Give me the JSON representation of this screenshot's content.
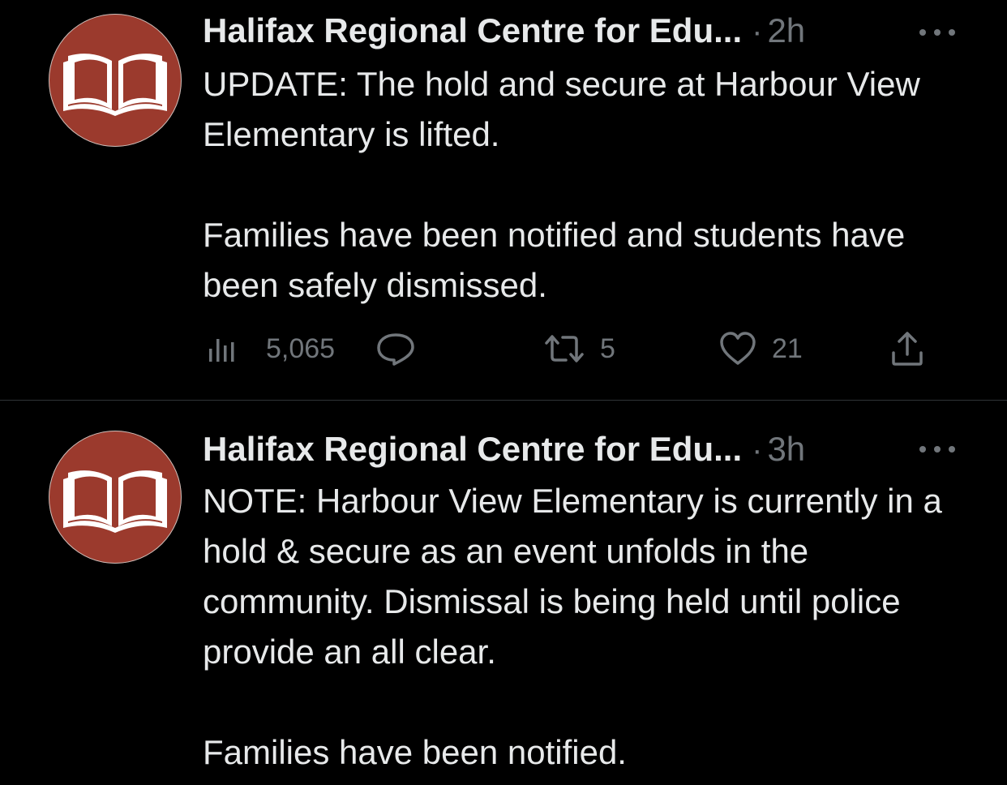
{
  "tweets": [
    {
      "author": "Halifax Regional Centre for Edu...",
      "separator": "·",
      "time": "2h",
      "more_icon": "more-horizontal-icon",
      "text_paragraphs": [
        "UPDATE: The hold and secure at Harbour View Elementary is lifted.",
        "Families have been notified and students have been safely dismissed."
      ],
      "stats": {
        "views": "5,065",
        "retweets": "5",
        "likes": "21"
      },
      "icons": {
        "views": "analytics-icon",
        "reply": "reply-icon",
        "retweet": "retweet-icon",
        "like": "heart-icon",
        "share": "share-icon"
      }
    },
    {
      "author": "Halifax Regional Centre for Edu...",
      "separator": "·",
      "time": "3h",
      "more_icon": "more-horizontal-icon",
      "text_paragraphs": [
        "NOTE: Harbour View Elementary is currently in a hold & secure as an event unfolds in the community. Dismissal is being held until police provide an all clear.",
        "Families have been notified."
      ]
    }
  ],
  "avatar_icon": "open-book-icon",
  "colors": {
    "background": "#000000",
    "text_primary": "#e7e9ea",
    "text_secondary": "#71767b",
    "avatar_bg": "#9b3a2d",
    "divider": "#2f3336"
  }
}
